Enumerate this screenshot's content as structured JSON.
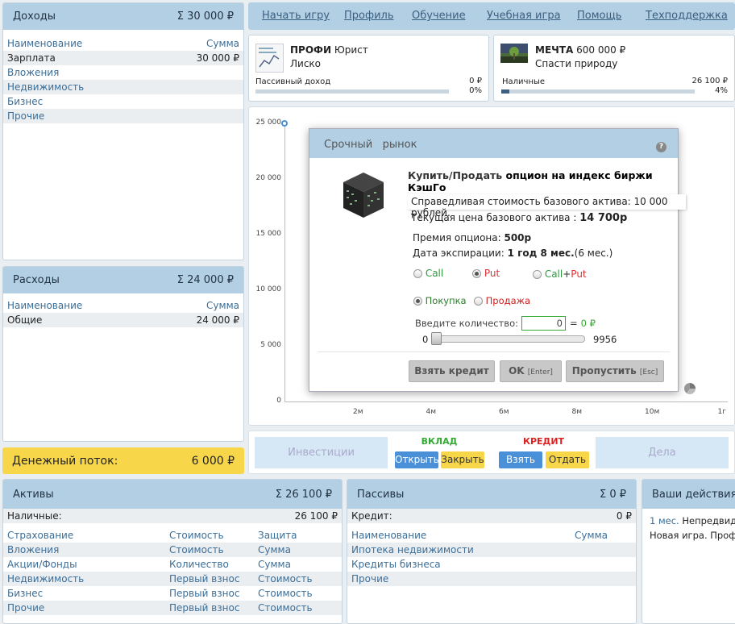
{
  "income": {
    "title": "Доходы",
    "total": "Σ 30 000 ₽",
    "col_name": "Наименование",
    "col_sum": "Сумма",
    "rows": [
      {
        "name": "Зарплата",
        "sum": "30 000 ₽"
      },
      {
        "name": "Вложения",
        "sum": ""
      },
      {
        "name": "Недвижимость",
        "sum": ""
      },
      {
        "name": "Бизнес",
        "sum": ""
      },
      {
        "name": "Прочие",
        "sum": ""
      }
    ]
  },
  "expenses": {
    "title": "Расходы",
    "total": "Σ 24 000 ₽",
    "col_name": "Наименование",
    "col_sum": "Сумма",
    "rows": [
      {
        "name": "Общие",
        "sum": "24 000 ₽"
      }
    ]
  },
  "cashflow": {
    "label": "Денежный поток:",
    "value": "6 000 ₽"
  },
  "nav": {
    "items": [
      "Начать игру",
      "Профиль",
      "Обучение",
      "Учебная игра",
      "Помощь",
      "Техподдержка"
    ]
  },
  "profile": {
    "role": "ПРОФИ",
    "profession": "Юрист",
    "name": "Лиско",
    "passive_label": "Пассивный доход",
    "passive_value": "0 ₽",
    "passive_pct": "0%",
    "passive_fraction": 0
  },
  "dream": {
    "label": "МЕЧТА",
    "price": "600 000 ₽",
    "name": "Спасти природу",
    "cash_label": "Наличные",
    "cash_value": "26 100 ₽",
    "cash_pct": "4%",
    "cash_fraction": 0.04
  },
  "chart_data": {
    "type": "line",
    "y_ticks": [
      "25 000",
      "20 000",
      "15 000",
      "10 000",
      "5 000",
      "0"
    ],
    "x_ticks": [
      "2м",
      "4м",
      "6м",
      "8м",
      "10м",
      "1г"
    ],
    "ylim": [
      0,
      25000
    ],
    "series": [
      {
        "values": [
          25000
        ]
      }
    ]
  },
  "modal": {
    "title1": "Срочный",
    "title2": "рынок",
    "heading1": "Купить/Продать",
    "heading2": "опцион на индекс биржи КэшГо",
    "fair_label1": "Справедливая стоимость",
    "fair_label2": "базового актива:",
    "fair_value": "10 000 рублей.",
    "price_label1": "Текущая цена",
    "price_label2": "базового актива :",
    "price_value": "14 700р",
    "premium_label": "Премия опциона:",
    "premium_value": "500р",
    "exp_label": "Дата экспирации:",
    "exp_value": "1 год 8 мес.",
    "exp_extra": "(6 мес.)",
    "opt_call": "Call",
    "opt_put": "Put",
    "opt_callput_call": "Call",
    "opt_callput_plus": "+",
    "opt_callput_put": "Put",
    "buy": "Покупка",
    "sell": "Продажа",
    "qty_label": "Введите количество:",
    "qty_value": "0",
    "qty_eq": "=",
    "qty_sum": "0 ₽",
    "slider_min": "0",
    "slider_max": "9956",
    "btn_credit": "Взять кредит",
    "btn_ok": "OK",
    "btn_ok_key": "[Enter]",
    "btn_skip": "Пропустить",
    "btn_skip_key": "[Esc]"
  },
  "actions": {
    "invest": "Инвестиции",
    "deposit_title": "ВКЛАД",
    "deposit_open": "Открыть",
    "deposit_close": "Закрыть",
    "credit_title": "КРЕДИТ",
    "credit_take": "Взять",
    "credit_give": "Отдать",
    "deals": "Дела"
  },
  "assets": {
    "title": "Активы",
    "total": "Σ 26 100 ₽",
    "cash_label": "Наличные:",
    "cash_value": "26 100 ₽",
    "rows": [
      [
        "Страхование",
        "Стоимость",
        "Защита"
      ],
      [
        "Вложения",
        "Стоимость",
        "Сумма"
      ],
      [
        "Акции/Фонды",
        "Количество",
        "Сумма"
      ],
      [
        "Недвижимость",
        "Первый взнос",
        "Стоимость"
      ],
      [
        "Бизнес",
        "Первый взнос",
        "Стоимость"
      ],
      [
        "Прочие",
        "Первый взнос",
        "Стоимость"
      ]
    ]
  },
  "liabilities": {
    "title": "Пассивы",
    "total": "Σ 0 ₽",
    "credit_label": "Кредит:",
    "credit_value": "0 ₽",
    "col_name": "Наименование",
    "col_sum": "Сумма",
    "rows": [
      "Ипотека недвижимости",
      "Кредиты бизнеса",
      "Прочие"
    ]
  },
  "log": {
    "title": "Ваши действия",
    "line1_month": "1 мес.",
    "line1_text": "Непредвиде",
    "line2": "Новая игра. Профе"
  }
}
